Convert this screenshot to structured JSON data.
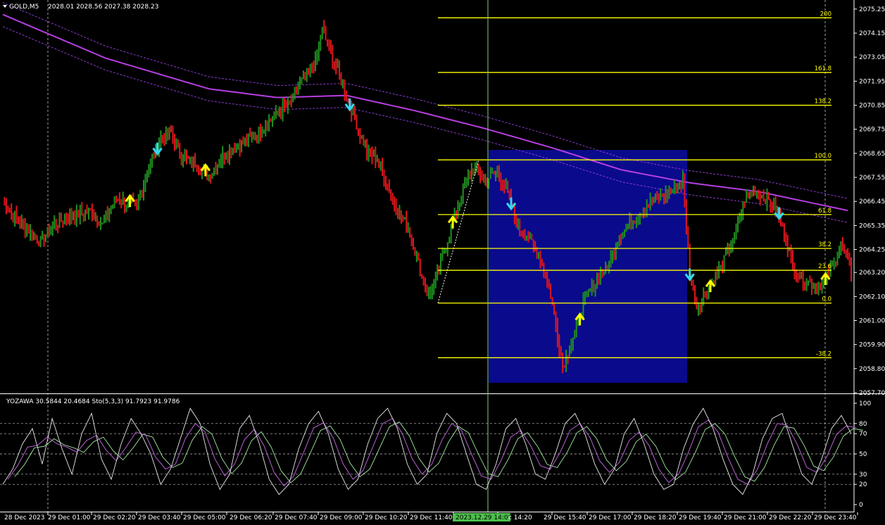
{
  "header": {
    "symbol_label": "GOLD,M5",
    "ohlc_text": "2028.01 2028.56 2027.38 2028.23"
  },
  "indicator_header": {
    "text": "YOZAWA 30.5844 20.4684  Sto(5,3,3) 91.7923 91.9786"
  },
  "colors": {
    "background": "#000000",
    "bull_bar": "#1f8f1f",
    "bear_bar": "#e0161b",
    "moving_average": "#b53fe0",
    "envelope": "#8b3bd0",
    "fib_lines": "#ffff00",
    "selection_box": "#0a0a8c",
    "arrow_up": "#ffff00",
    "arrow_down": "#35d7f0",
    "crosshair": "#7fd07f",
    "time_highlight": "#4bc04b",
    "grid": "#c8c8c8",
    "stoch_main": "#e8e8e8",
    "stoch_signal": "#b760d4",
    "yozawa_line": "#b5ffb5"
  },
  "price_axis": {
    "labels": [
      "2075.25",
      "2074.15",
      "2073.05",
      "2071.95",
      "2070.85",
      "2069.75",
      "2068.65",
      "2067.55",
      "2066.45",
      "2065.35",
      "2064.25",
      "2063.20",
      "2062.10",
      "2061.00",
      "2059.90",
      "2058.80",
      "2057.70"
    ]
  },
  "indicator_axis": {
    "labels": [
      "100",
      "80",
      "70",
      "50",
      "30",
      "20",
      "0"
    ]
  },
  "time_axis": {
    "labels": [
      "28 Dec 2023",
      "29 Dec 01:00",
      "29 Dec 02:20",
      "29 Dec 03:40",
      "29 Dec 05:00",
      "29 Dec 06:20",
      "29 Dec 07:40",
      "29 Dec 09:00",
      "29 Dec 10:20",
      "29 Dec 11:40",
      "2023.12.29 14:00",
      "c 14:20",
      "29 Dec 15:40",
      "29 Dec 17:00",
      "29 Dec 18:20",
      "29 Dec 19:40",
      "29 Dec 21:00",
      "29 Dec 22:20",
      "29 Dec 23:40"
    ],
    "highlighted": "2023.12.29 14:00"
  },
  "fibonacci": {
    "levels": [
      {
        "label": "200",
        "price": 2074.85
      },
      {
        "label": "161.8",
        "price": 2072.35
      },
      {
        "label": "138.2",
        "price": 2070.85
      },
      {
        "label": "100.0",
        "price": 2068.35
      },
      {
        "label": "61.8",
        "price": 2065.85
      },
      {
        "label": "38.2",
        "price": 2064.3
      },
      {
        "label": "23.6",
        "price": 2063.3
      },
      {
        "label": "0.0",
        "price": 2061.8
      },
      {
        "label": "-38.2",
        "price": 2059.3
      }
    ]
  },
  "chart_data": {
    "type": "candlestick",
    "instrument": "GOLD",
    "timeframe": "M5",
    "ylim": [
      2057.7,
      2075.6
    ],
    "series_shape": [
      [
        0,
        2066.6
      ],
      [
        6,
        2065.8
      ],
      [
        14,
        2065.2
      ],
      [
        22,
        2064.6
      ],
      [
        30,
        2065.4
      ],
      [
        40,
        2065.8
      ],
      [
        52,
        2066.0
      ],
      [
        58,
        2065.4
      ],
      [
        66,
        2066.6
      ],
      [
        78,
        2066.2
      ],
      [
        86,
        2068.2
      ],
      [
        92,
        2069.4
      ],
      [
        98,
        2069.6
      ],
      [
        104,
        2068.5
      ],
      [
        112,
        2068.2
      ],
      [
        120,
        2067.6
      ],
      [
        128,
        2068.5
      ],
      [
        136,
        2069.0
      ],
      [
        146,
        2069.4
      ],
      [
        156,
        2070.2
      ],
      [
        162,
        2070.6
      ],
      [
        168,
        2071.0
      ],
      [
        176,
        2072.2
      ],
      [
        182,
        2072.8
      ],
      [
        186,
        2074.3
      ],
      [
        190,
        2073.4
      ],
      [
        196,
        2072.2
      ],
      [
        200,
        2071.3
      ],
      [
        206,
        2070.0
      ],
      [
        212,
        2068.7
      ],
      [
        218,
        2068.4
      ],
      [
        224,
        2067.2
      ],
      [
        230,
        2066.0
      ],
      [
        236,
        2065.3
      ],
      [
        240,
        2064.2
      ],
      [
        244,
        2063.0
      ],
      [
        248,
        2062.1
      ],
      [
        254,
        2063.4
      ],
      [
        262,
        2065.5
      ],
      [
        268,
        2067.0
      ],
      [
        274,
        2068.1
      ],
      [
        280,
        2067.4
      ],
      [
        288,
        2067.8
      ],
      [
        294,
        2066.8
      ],
      [
        300,
        2065.2
      ],
      [
        306,
        2064.8
      ],
      [
        312,
        2064.0
      ],
      [
        318,
        2062.6
      ],
      [
        322,
        2060.8
      ],
      [
        326,
        2058.9
      ],
      [
        332,
        2060.2
      ],
      [
        338,
        2061.8
      ],
      [
        346,
        2062.9
      ],
      [
        352,
        2063.4
      ],
      [
        358,
        2064.8
      ],
      [
        366,
        2065.5
      ],
      [
        374,
        2066.2
      ],
      [
        382,
        2066.6
      ],
      [
        390,
        2067.0
      ],
      [
        396,
        2067.4
      ],
      [
        400,
        2063.2
      ],
      [
        404,
        2061.6
      ],
      [
        410,
        2062.4
      ],
      [
        418,
        2063.4
      ],
      [
        426,
        2064.8
      ],
      [
        432,
        2066.6
      ],
      [
        438,
        2067.0
      ],
      [
        444,
        2066.6
      ],
      [
        450,
        2066.2
      ],
      [
        456,
        2064.8
      ],
      [
        460,
        2063.4
      ],
      [
        466,
        2062.9
      ],
      [
        472,
        2062.6
      ],
      [
        478,
        2062.7
      ],
      [
        484,
        2063.6
      ],
      [
        488,
        2064.6
      ],
      [
        494,
        2063.2
      ]
    ],
    "moving_average_shape": [
      [
        0,
        2075.0
      ],
      [
        60,
        2073.0
      ],
      [
        120,
        2071.6
      ],
      [
        160,
        2071.2
      ],
      [
        200,
        2071.3
      ],
      [
        240,
        2070.6
      ],
      [
        280,
        2069.8
      ],
      [
        320,
        2068.9
      ],
      [
        360,
        2067.9
      ],
      [
        400,
        2067.3
      ],
      [
        440,
        2066.9
      ],
      [
        494,
        2066.0
      ]
    ],
    "signals": [
      {
        "type": "buy",
        "bar": 74
      },
      {
        "type": "sell",
        "bar": 90
      },
      {
        "type": "buy",
        "bar": 118
      },
      {
        "type": "sell",
        "bar": 202
      },
      {
        "type": "buy",
        "bar": 262
      },
      {
        "type": "sell",
        "bar": 296
      },
      {
        "type": "buy",
        "bar": 336
      },
      {
        "type": "sell",
        "bar": 400
      },
      {
        "type": "buy",
        "bar": 412
      },
      {
        "type": "sell",
        "bar": 452
      },
      {
        "type": "buy",
        "bar": 479
      }
    ]
  },
  "stochastic": {
    "levels": [
      80,
      70,
      50,
      30,
      20
    ],
    "range": [
      0,
      100
    ],
    "main_shape": [
      20,
      35,
      60,
      75,
      40,
      85,
      55,
      30,
      70,
      90,
      45,
      25,
      60,
      85,
      70,
      50,
      20,
      35,
      65,
      95,
      80,
      40,
      15,
      30,
      75,
      88,
      60,
      25,
      10,
      20,
      55,
      80,
      92,
      70,
      35,
      15,
      25,
      60,
      85,
      95,
      75,
      40,
      20,
      30,
      70,
      90,
      80,
      50,
      20,
      15,
      40,
      75,
      85,
      60,
      30,
      25,
      50,
      80,
      90,
      70,
      40,
      20,
      35,
      70,
      85,
      60,
      30,
      15,
      20,
      55,
      80,
      95,
      75,
      45,
      20,
      10,
      30,
      65,
      85,
      90,
      60,
      30,
      20,
      45,
      75,
      88,
      70
    ]
  }
}
